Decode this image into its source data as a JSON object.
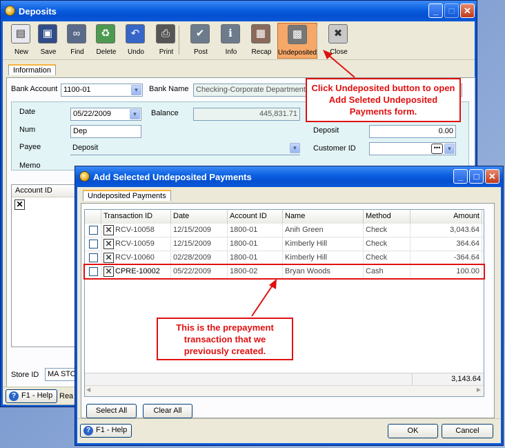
{
  "deposits": {
    "title": "Deposits",
    "toolbar": [
      {
        "label": "New",
        "icon": "new-document-icon"
      },
      {
        "label": "Save",
        "icon": "floppy-disk-icon"
      },
      {
        "label": "Find",
        "icon": "binoculars-icon"
      },
      {
        "label": "Delete",
        "icon": "recycle-bin-icon"
      },
      {
        "label": "Undo",
        "icon": "undo-arrow-icon"
      },
      {
        "label": "Print",
        "icon": "printer-icon"
      },
      {
        "label": "Post",
        "icon": "post-check-icon"
      },
      {
        "label": "Info",
        "icon": "info-icon"
      },
      {
        "label": "Recap",
        "icon": "recap-grid-icon"
      },
      {
        "label": "Undeposited",
        "icon": "safe-icon"
      },
      {
        "label": "Close",
        "icon": "close-window-icon"
      }
    ],
    "tab_information": "Information",
    "bank_account_label": "Bank Account",
    "bank_account_value": "1100-01",
    "bank_name_label": "Bank Name",
    "bank_name_value": "Checking-Corporate Department",
    "date_label": "Date",
    "date_value": "05/22/2009",
    "balance_label": "Balance",
    "balance_value": "445,831.71",
    "num_label": "Num",
    "num_value": "Dep",
    "payee_label": "Payee",
    "payee_value": "Deposit",
    "memo_label": "Memo",
    "deposit_label": "Deposit",
    "deposit_value": "0.00",
    "customer_id_label": "Customer ID",
    "grid_header_account": "Account ID",
    "store_id_label": "Store ID",
    "store_id_value": "MA STO",
    "help_label": "F1 - Help",
    "status_text": "Rea"
  },
  "dialog": {
    "title": "Add Selected Undeposited Payments",
    "tab": "Undeposited Payments",
    "columns": [
      "Transaction ID",
      "Date",
      "Account ID",
      "Name",
      "Method",
      "Amount"
    ],
    "rows": [
      {
        "id": "RCV-10058",
        "date": "12/15/2009",
        "account": "1800-01",
        "name": "Anih Green",
        "method": "Check",
        "amount": "3,043.64"
      },
      {
        "id": "RCV-10059",
        "date": "12/15/2009",
        "account": "1800-01",
        "name": "Kimberly  Hill",
        "method": "Check",
        "amount": "364.64"
      },
      {
        "id": "RCV-10060",
        "date": "02/28/2009",
        "account": "1800-01",
        "name": "Kimberly  Hill",
        "method": "Check",
        "amount": "-364.64"
      },
      {
        "id": "CPRE-10002",
        "date": "05/22/2009",
        "account": "1800-02",
        "name": "Bryan Woods",
        "method": "Cash",
        "amount": "100.00"
      }
    ],
    "total": "3,143.64",
    "select_all": "Select All",
    "clear_all": "Clear All",
    "help": "F1 - Help",
    "ok": "OK",
    "cancel": "Cancel"
  },
  "callouts": {
    "undeposited": "Click Undeposited button to open Add Seleted Undeposited Payments form.",
    "prepayment": "This is the prepayment transaction that we previously created."
  },
  "colors": {
    "callout_red": "#e01010",
    "titlebar_blue": "#0a58d8",
    "active_tool": "#f6a869"
  }
}
